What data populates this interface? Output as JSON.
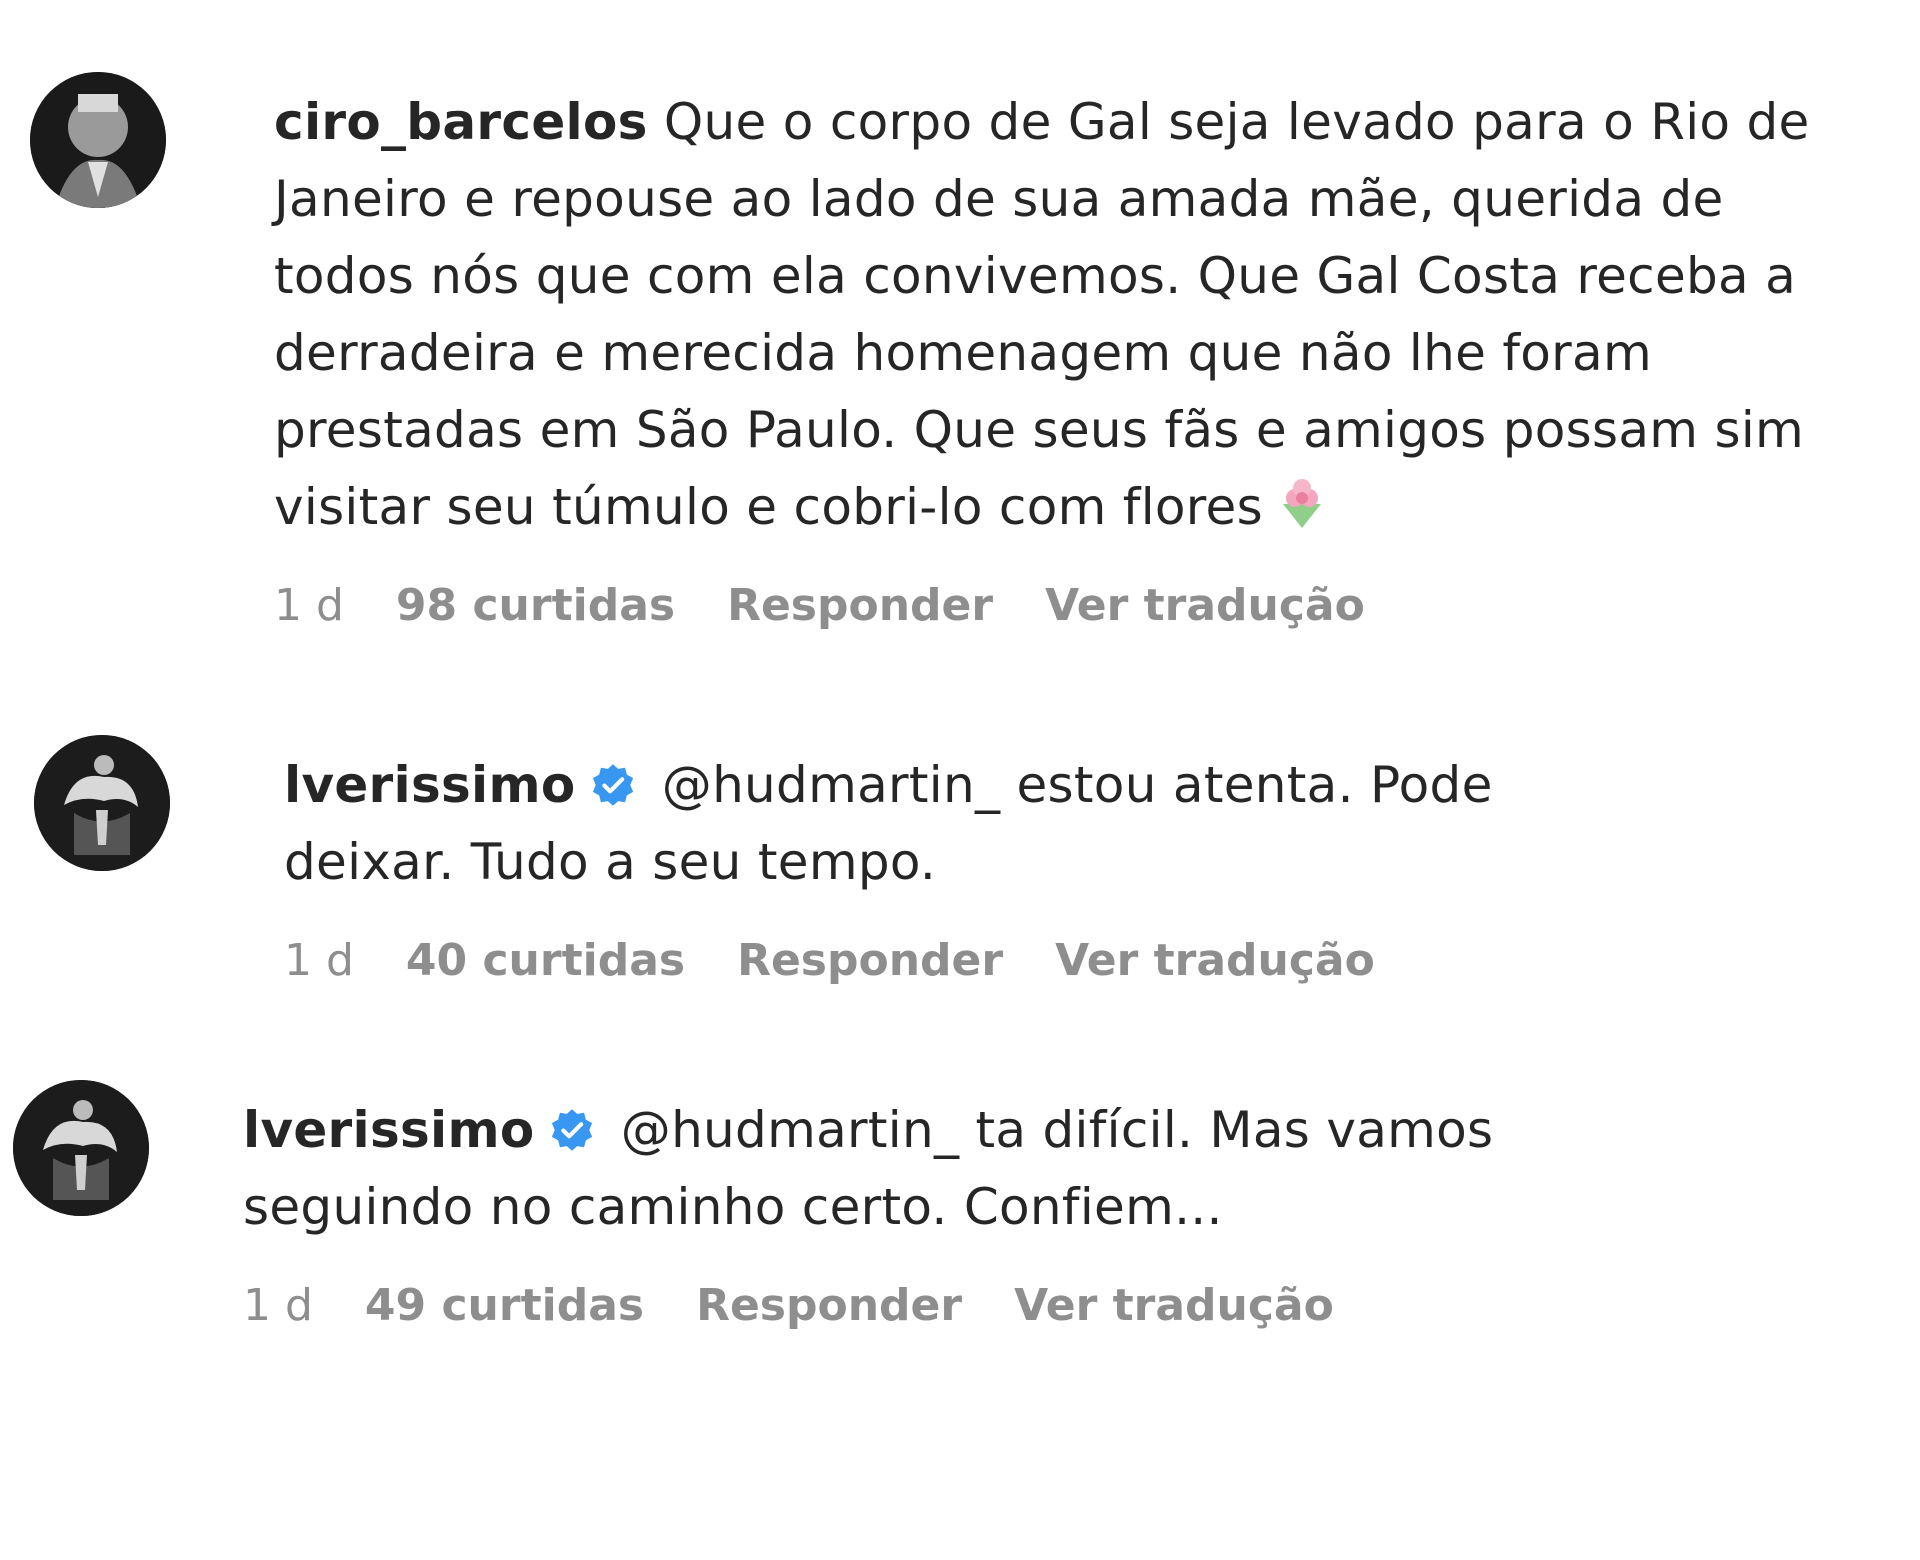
{
  "comments": [
    {
      "username": "ciro_barcelos",
      "verified": false,
      "text": "Que o corpo de Gal seja levado para o Rio de Janeiro e repouse ao lado de sua amada mãe, querida de todos nós que com ela convivemos. Que Gal Costa receba a derradeira e merecida homenagem que não lhe foram prestadas em São Paulo. Que seus fãs e amigos possam sim visitar seu túmulo e cobri-lo com flores",
      "emoji": "flower-bouquet-icon",
      "time": "1 d",
      "likes": "98 curtidas",
      "reply_label": "Responder",
      "translate_label": "Ver tradução"
    },
    {
      "username": "lverissimo",
      "verified": true,
      "mention": "@hudmartin_",
      "text": "estou atenta. Pode deixar. Tudo a seu tempo.",
      "time": "1 d",
      "likes": "40 curtidas",
      "reply_label": "Responder",
      "translate_label": "Ver tradução"
    },
    {
      "username": "lverissimo",
      "verified": true,
      "mention": "@hudmartin_",
      "text": "ta difícil. Mas vamos seguindo no caminho certo. Confiem...",
      "time": "1 d",
      "likes": "49 curtidas",
      "reply_label": "Responder",
      "translate_label": "Ver tradução"
    }
  ],
  "colors": {
    "text": "#262626",
    "meta": "#8e8e8e",
    "verified": "#3897f0"
  }
}
